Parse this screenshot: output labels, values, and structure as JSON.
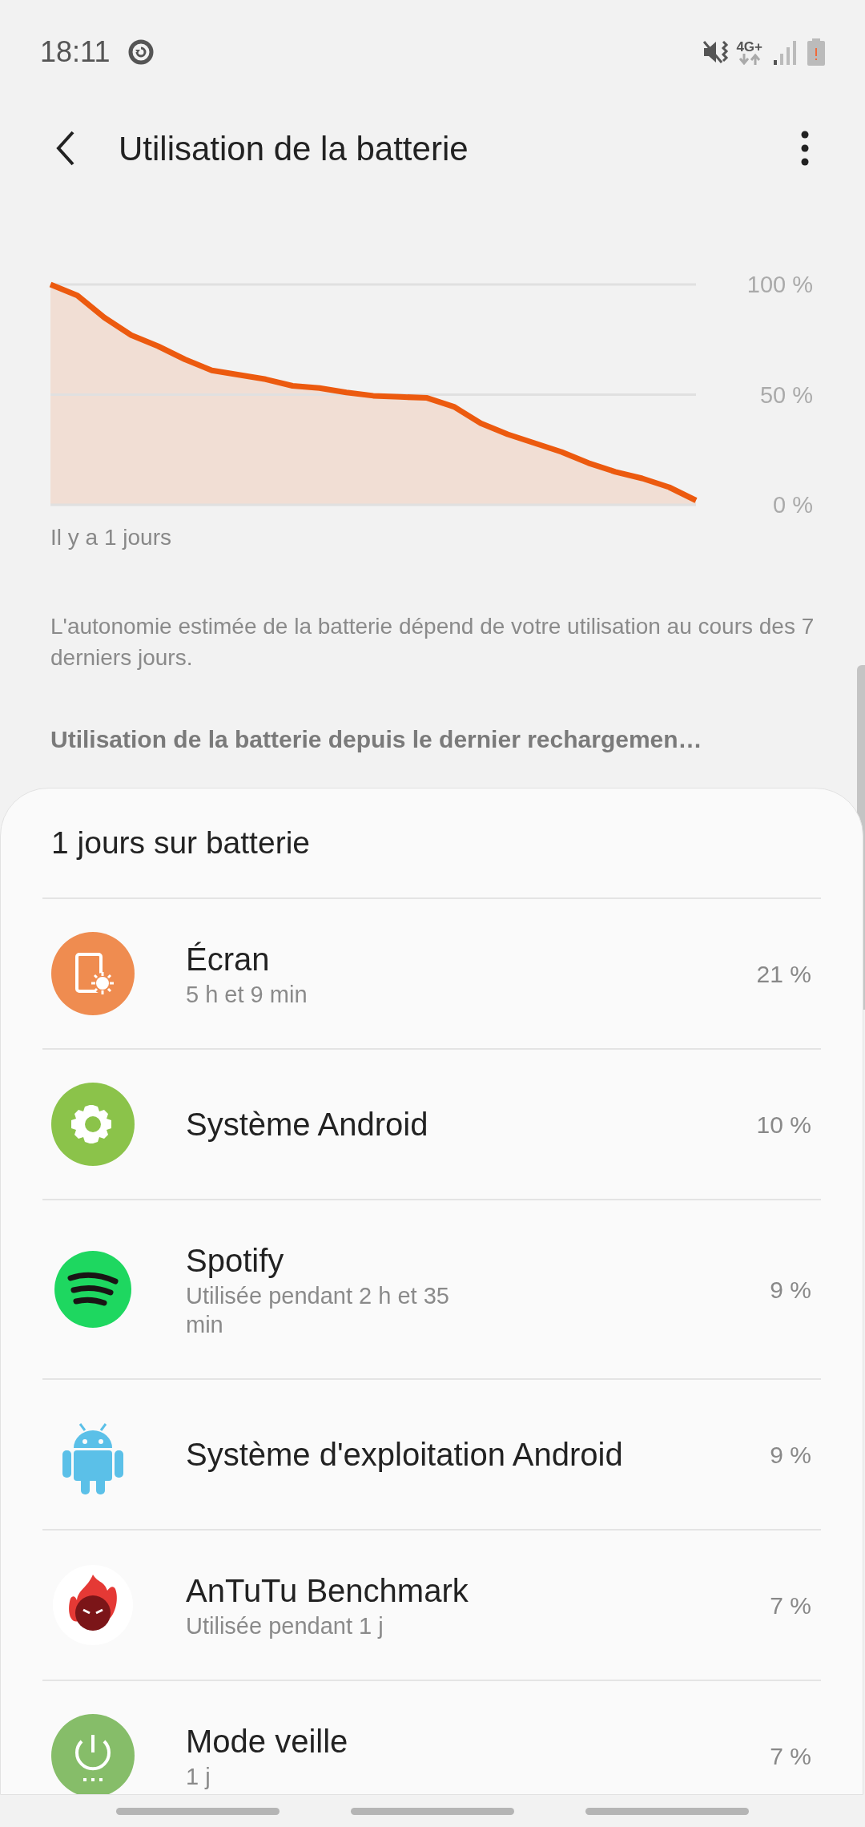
{
  "status_bar": {
    "time": "18:11",
    "network": "4G+"
  },
  "header": {
    "title": "Utilisation de la batterie"
  },
  "chart": {
    "chart_data": {
      "type": "area",
      "categories": [
        null,
        null,
        null,
        null,
        null,
        null,
        null,
        null,
        null,
        null,
        null,
        null,
        null,
        null,
        null,
        null,
        null,
        null,
        null,
        null,
        null,
        null,
        null,
        null,
        null
      ],
      "ylim": [
        0,
        100
      ],
      "yticks": [
        {
          "value": 0,
          "label": "0 %"
        },
        {
          "value": 50,
          "label": "50 %"
        },
        {
          "value": 100,
          "label": "100 %"
        }
      ],
      "series": [
        {
          "color": "#ec5a0f",
          "values": [
            100,
            95,
            85,
            77,
            72,
            66,
            61,
            59,
            57,
            54,
            53,
            51,
            49.5,
            49,
            48.5,
            44.5,
            37,
            32,
            28,
            24,
            19,
            15,
            12,
            8,
            2
          ]
        }
      ]
    },
    "time_label": "Il y a 1 jours"
  },
  "note": "L'autonomie estimée de la batterie dépend de votre utilisation au cours des 7 derniers jours.",
  "section_title": "Utilisation de la batterie depuis le dernier rechargemen…",
  "sheet": {
    "title": "1 jours sur batterie",
    "items": [
      {
        "name": "Écran",
        "detail": "5 h et 9 min",
        "percent": "21 %"
      },
      {
        "name": "Système Android",
        "percent": "10 %"
      },
      {
        "name": "Spotify",
        "detail": "Utilisée pendant 2 h et 35 min",
        "percent": "9 %"
      },
      {
        "name": "Système d'exploitation Android",
        "percent": "9 %"
      },
      {
        "name": "AnTuTu Benchmark",
        "detail": "Utilisée pendant 1 j",
        "percent": "7 %"
      },
      {
        "name": "Mode veille",
        "detail": "1 j",
        "percent": "7 %"
      }
    ]
  }
}
